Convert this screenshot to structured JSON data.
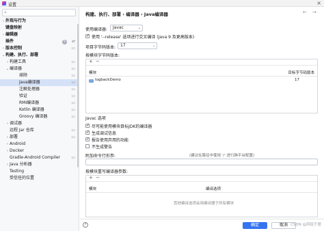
{
  "window": {
    "title": "设置"
  },
  "search": {
    "placeholder": ""
  },
  "sidebar": {
    "items": [
      {
        "label": "外观与行为",
        "arrow": "›"
      },
      {
        "label": "键盘映射",
        "arrow": ""
      },
      {
        "label": "编辑器",
        "arrow": "›"
      },
      {
        "label": "插件",
        "arrow": "",
        "badge": "5"
      },
      {
        "label": "版本控制",
        "arrow": "›"
      },
      {
        "label": "构建、执行、部署",
        "arrow": "⌄"
      },
      {
        "label": "构建工具",
        "arrow": "›"
      },
      {
        "label": "编译器",
        "arrow": "⌄"
      },
      {
        "label": "排除",
        "arrow": ""
      },
      {
        "label": "Java编译器",
        "arrow": ""
      },
      {
        "label": "注解处理器",
        "arrow": ""
      },
      {
        "label": "验证",
        "arrow": ""
      },
      {
        "label": "RMI编译器",
        "arrow": ""
      },
      {
        "label": "Kotlin 编译器",
        "arrow": ""
      },
      {
        "label": "Groovy 编译器",
        "arrow": ""
      },
      {
        "label": "调试器",
        "arrow": "›"
      },
      {
        "label": "远程 Jar 仓库",
        "arrow": ""
      },
      {
        "label": "部署",
        "arrow": "›"
      },
      {
        "label": "Android",
        "arrow": "›"
      },
      {
        "label": "Docker",
        "arrow": "›"
      },
      {
        "label": "Gradle-Android Compiler",
        "arrow": ""
      },
      {
        "label": "Java 分析器",
        "arrow": "›"
      },
      {
        "label": "Testing",
        "arrow": ""
      },
      {
        "label": "受信任的位置",
        "arrow": ""
      }
    ]
  },
  "breadcrumb": {
    "text": "构建、执行、部署  ›  编译器  ›  Java编译器"
  },
  "nav": {
    "back": "←",
    "forward": "→"
  },
  "compiler": {
    "label": "使用编译器:",
    "value": "Javac",
    "release_option": "使用 '--release' 选项进行交叉编译 (Java 9 及更高版本)",
    "bytecode_label": "项目字节码版本:",
    "bytecode_value": "17",
    "per_module_label": "按模块字节码版本:"
  },
  "module_table": {
    "add": "+",
    "remove": "−",
    "col_module": "模块",
    "col_target": "目标字节码版本",
    "rows": [
      {
        "module": "logbackDemo",
        "target": "17"
      }
    ]
  },
  "javac": {
    "section": "Javac 选项",
    "opt1": "尽可能使用模块目标JDK的编译器",
    "opt2": "生成调试信息",
    "opt3": "报告使用弃用的功能",
    "opt4": "不生成警告",
    "cmd_label": "附加命令行形参:",
    "cmd_hint": "(建议在路径中使用 '/' 进行跨平台配置)",
    "override_label": "按模块重写编译器参数:"
  },
  "override_table": {
    "add": "+",
    "remove": "−",
    "col_module": "模块",
    "col_options": "编译选项",
    "empty": "其他编译选项会用编译器于所有模块"
  },
  "buttons": {
    "ok": "确定",
    "cancel": "取消",
    "help": "?"
  },
  "watermark": "CSDN @风轻于居"
}
